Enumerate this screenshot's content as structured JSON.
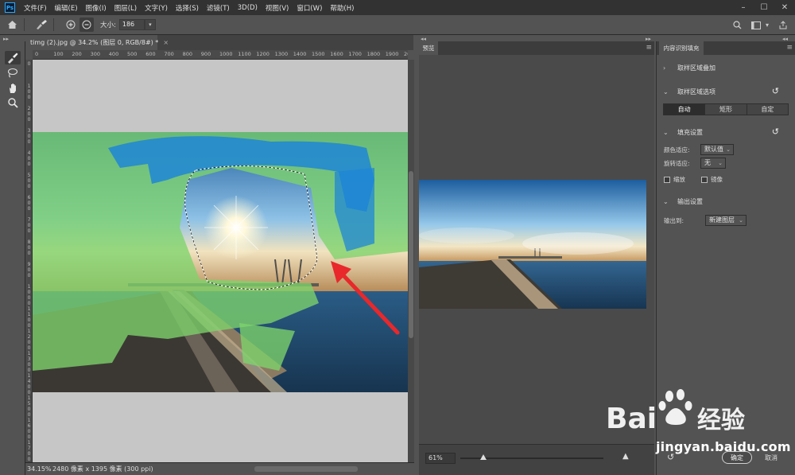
{
  "app": {
    "logo_text": "Ps"
  },
  "menu": [
    "文件(F)",
    "编辑(E)",
    "图像(I)",
    "图层(L)",
    "文字(Y)",
    "选择(S)",
    "滤镜(T)",
    "3D(D)",
    "视图(V)",
    "窗口(W)",
    "帮助(H)"
  ],
  "options_bar": {
    "size_label": "大小:",
    "size_value": "186"
  },
  "document": {
    "tab_title": "timg (2).jpg @ 34.2% (图层 0, RGB/8#) *",
    "ruler_top": [
      "0",
      "100",
      "200",
      "300",
      "400",
      "500",
      "600",
      "700",
      "800",
      "900",
      "1000",
      "1100",
      "1200",
      "1300",
      "1400",
      "1500",
      "1600",
      "1700",
      "1800",
      "1900",
      "2000"
    ],
    "ruler_left": [
      "0",
      "100",
      "200",
      "300",
      "400",
      "500",
      "600",
      "700",
      "800",
      "900",
      "1000",
      "1100",
      "1200",
      "1300",
      "1400",
      "1500",
      "1600",
      "1700"
    ],
    "status_zoom": "34.15%",
    "status_info": "2480 像素 x 1395 像素 (300 ppi)"
  },
  "preview": {
    "tab": "预览",
    "zoom": "61%",
    "zoom_level": 0.14
  },
  "content_aware": {
    "tab": "内容识别填充",
    "sampling_overlay": "取样区域叠加",
    "sampling_options": "取样区域选项",
    "sampling_modes": [
      "自动",
      "矩形",
      "自定"
    ],
    "sampling_selected": "自动",
    "fill_settings": "填充设置",
    "color_adapt_label": "颜色适应:",
    "color_adapt_value": "默认值",
    "rotation_adapt_label": "旋转适应:",
    "rotation_adapt_value": "无",
    "scale_label": "缩放",
    "mirror_label": "镜像",
    "output_settings": "输出设置",
    "output_to_label": "输出到:",
    "output_to_value": "新建图层",
    "ok": "确定",
    "cancel": "取消"
  },
  "watermark": {
    "url": "jingyan.baidu.com"
  },
  "colors": {
    "overlay_green": "#7ed36b",
    "brush_blue": "#1f86d6",
    "arrow_red": "#e8282b"
  }
}
